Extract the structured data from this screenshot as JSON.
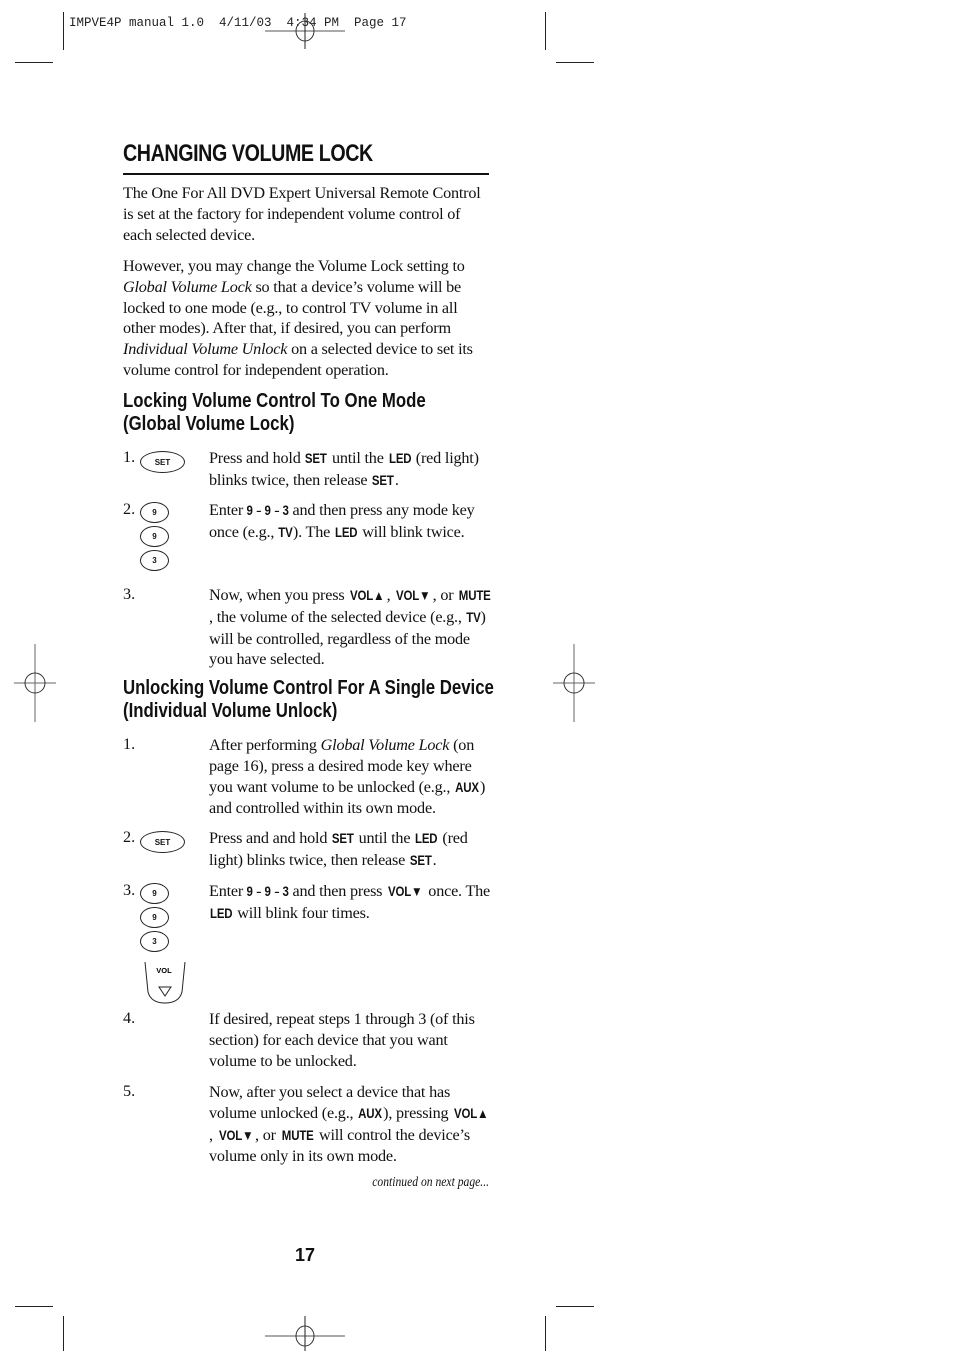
{
  "slug": "IMPVE4P manual 1.0  4/11/03  4:34 PM  Page 17",
  "title": "CHANGING VOLUME LOCK",
  "intro": [
    "The One For All DVD Expert Universal Remote Control is set at the factory for independent volume control of each selected device.",
    {
      "parts": [
        "However, you may change the Volume Lock setting to ",
        "Global Volume Lock",
        " so that a device’s volume will be locked to one mode (e.g., to control TV volume in all other modes). After that, if desired, you can perform ",
        "Individual Volume Unlock",
        " on a selected device to set its volume control for independent operation."
      ]
    }
  ],
  "section1": {
    "heading_line1": "Locking Volume Control To One Mode",
    "heading_line2": "(Global Volume Lock)",
    "steps": [
      {
        "number": "1.",
        "buttons": [
          "SET"
        ]
      },
      {
        "number": "2.",
        "buttons": [
          "9",
          "9",
          "3"
        ]
      },
      {
        "number": "3.",
        "buttons": []
      }
    ]
  },
  "section2": {
    "heading_line1": "Unlocking Volume Control For A Single Device",
    "heading_line2": "(Individual Volume Unlock)",
    "steps": [
      {
        "number": "1.",
        "buttons": []
      },
      {
        "number": "2.",
        "buttons": [
          "SET"
        ]
      },
      {
        "number": "3.",
        "buttons": [
          "9",
          "9",
          "3",
          "VOL"
        ]
      },
      {
        "number": "4.",
        "buttons": []
      },
      {
        "number": "5.",
        "buttons": []
      }
    ]
  },
  "text": {
    "s1_1a": "Press and hold ",
    "set": "SET",
    "s1_1b": " until the ",
    "led": "LED",
    "s1_1c": " (red light) blinks twice, then release ",
    "dot": ".",
    "s1_2a": "Enter ",
    "nine": "9",
    "dash": " - ",
    "three": "3",
    "s1_2b": " and then press any mode key once (e.g., ",
    "tv": "TV",
    "s1_2c": "). The ",
    "s1_2d": " will blink twice.",
    "s1_3a": "Now, when you press ",
    "volup": "VOL▲",
    "comma": ", ",
    "voldown": "VOL▼",
    "or": ", or ",
    "mute": "MUTE",
    "s1_3b": ", the volume of the selected device (e.g., ",
    "s1_3c": ") will be controlled, regardless of the mode you have selected.",
    "s2_1a": "After performing ",
    "s2_1gvl": "Global Volume Lock",
    "s2_1b": " (on page 16), press a desired mode key where you want volume to be unlocked (e.g., ",
    "aux": "AUX",
    "s2_1c": ") and controlled within its own mode.",
    "s2_2a": "Press and and hold ",
    "s2_2b": " (red light) blinks twice, then release ",
    "s2_3b": " and then press ",
    "s2_3c": " once. The ",
    "s2_3d": " will blink four times.",
    "s2_4": "If desired, repeat steps 1 through 3 (of this section) for each device that you want volume to be unlocked.",
    "s2_5a": "Now, after you select a device that has volume unlocked (e.g., ",
    "s2_5b": "), pressing ",
    "s2_5c": ", or ",
    "s2_5d": " will control the device’s volume only in its own mode.",
    "vol_label": "VOL"
  },
  "footer": {
    "continued": "continued on next page...",
    "page_number": "17"
  }
}
